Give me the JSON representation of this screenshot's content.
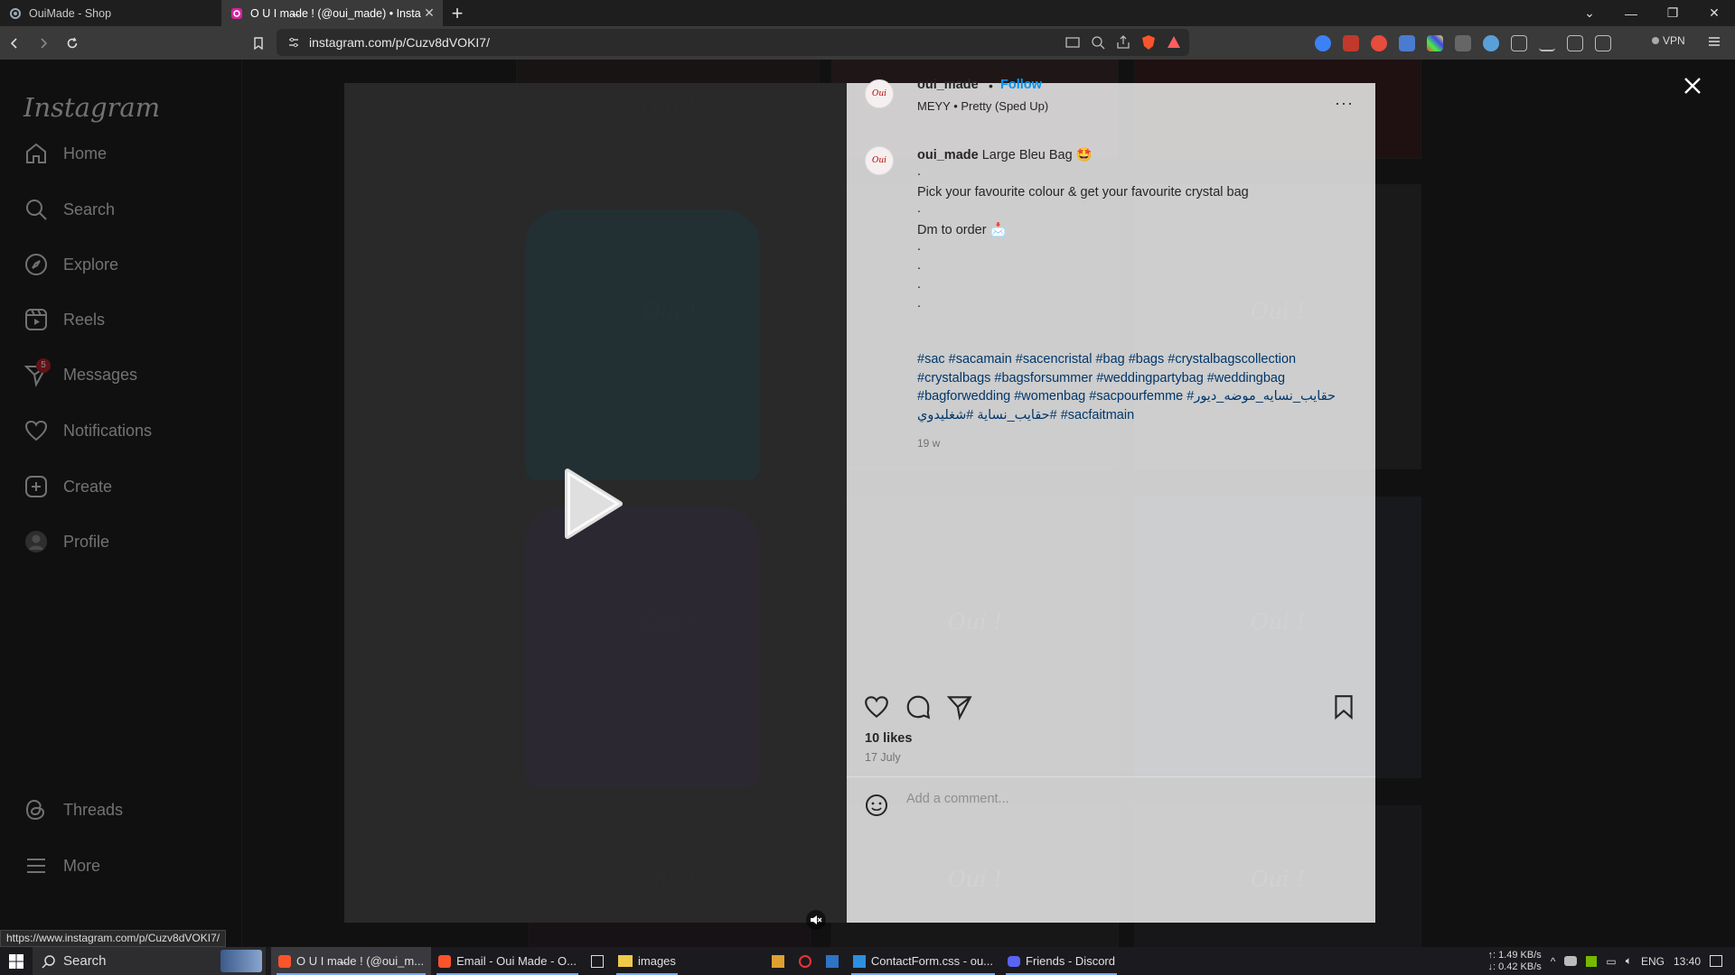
{
  "browser": {
    "tabs": [
      {
        "label": "OuiMade - Shop",
        "active": false
      },
      {
        "label": "O U I ma̶de ! (@oui_made) • Insta",
        "active": true
      }
    ],
    "url": "instagram.com/p/Cuzv8dVOKI7/",
    "vpn_label": "VPN",
    "status_url": "https://www.instagram.com/p/Cuzv8dVOKI7/"
  },
  "sidebar": {
    "logo": "Instagram",
    "items": [
      {
        "label": "Home",
        "icon": "home-icon"
      },
      {
        "label": "Search",
        "icon": "search-icon"
      },
      {
        "label": "Explore",
        "icon": "compass-icon"
      },
      {
        "label": "Reels",
        "icon": "reels-icon"
      },
      {
        "label": "Messages",
        "icon": "messenger-icon",
        "badge": "5"
      },
      {
        "label": "Notifications",
        "icon": "heart-icon"
      },
      {
        "label": "Create",
        "icon": "plus-square-icon"
      },
      {
        "label": "Profile",
        "icon": "avatar"
      }
    ],
    "bottom": [
      {
        "label": "Threads",
        "icon": "threads-icon"
      },
      {
        "label": "More",
        "icon": "menu-icon"
      }
    ]
  },
  "feed": {
    "watermark": "Oui !"
  },
  "post": {
    "username": "oui_made",
    "separator": "•",
    "follow_label": "Follow",
    "audio": "MEYY • Pretty (Sped Up)",
    "more_label": "···",
    "caption_user": "oui_made",
    "caption_title": "Large Bleu Bag 🤩",
    "caption_lines": [
      ".",
      "Pick your favourite colour & get your favourite crystal bag",
      ".",
      "Dm to order 📩",
      ".",
      ".",
      ".",
      "."
    ],
    "hashtags": "#sac #sacamain #sacencristal #bag #bags #crystalbagscollection #crystalbags #bagsforsummer #weddingpartybag #weddingbag #bagforwedding #womenbag #sacpourfemme #حقايب_نسايه_موضه_ديور #حقايب_نساية #شغليدوي #sacfaitmain",
    "age": "19 w",
    "likes": "10 likes",
    "date": "17 July",
    "comment_placeholder": "Add a comment..."
  },
  "taskbar": {
    "search": "Search",
    "items": [
      {
        "label": "O U I ma̶de ! (@oui_m...",
        "active": true
      },
      {
        "label": "Email - Oui Made - O...",
        "active": false
      },
      {
        "label": "",
        "active": false
      },
      {
        "label": "images",
        "active": false
      },
      {
        "label": "",
        "active": false
      },
      {
        "label": "",
        "active": false
      },
      {
        "label": "",
        "active": false
      },
      {
        "label": "ContactForm.css - ou...",
        "active": false
      },
      {
        "label": "Friends - Discord",
        "active": false
      }
    ],
    "net_up": "↑: 1.49 KB/s",
    "net_down": "↓: 0.42 KB/s",
    "lang": "ENG",
    "clock": "13:40"
  }
}
